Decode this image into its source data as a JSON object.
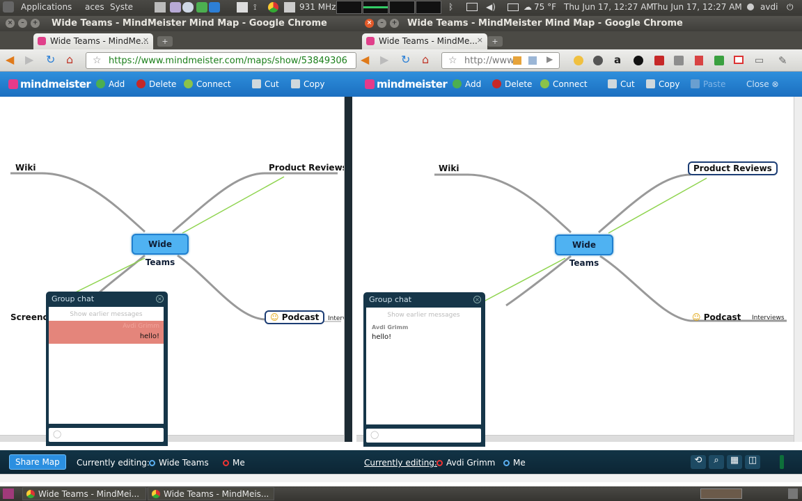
{
  "panel": {
    "applications": "Applications",
    "places": "aces",
    "system": "Syste",
    "cpu": "931 MHz",
    "weather": "75 °F",
    "clock1": "Thu Jun 17, 12:27 AM",
    "clock2": "Thu Jun 17, 12:27 AM",
    "user": "avdi"
  },
  "left_window": {
    "title": "Wide Teams - MindMeister Mind Map - Google Chrome",
    "tab_label": "Wide Teams - MindMe...",
    "url": "https://www.mindmeister.com/maps/show/53849306",
    "toolbar": {
      "add": "Add",
      "delete": "Delete",
      "connect": "Connect",
      "cut": "Cut",
      "copy": "Copy"
    },
    "nodes": {
      "center": "Wide Teams",
      "wiki": "Wiki",
      "product_reviews": "Product Reviews",
      "screencasts": "Screenca",
      "podcast": "Podcast",
      "interviews": "Interv"
    },
    "chat": {
      "title": "Group chat",
      "show_earlier": "Show earlier messages",
      "sender": "Avdi Grimm",
      "message": "hello!"
    },
    "bottom": {
      "share": "Share Map",
      "editing_label": "Currently editing:",
      "editor1": "Wide Teams",
      "editor2": "Me"
    }
  },
  "right_window": {
    "title": "Wide Teams - MindMeister Mind Map - Google Chrome",
    "tab_label": "Wide Teams - MindMe...",
    "url": "http://www",
    "toolbar": {
      "add": "Add",
      "delete": "Delete",
      "connect": "Connect",
      "cut": "Cut",
      "copy": "Copy",
      "paste": "Paste",
      "close": "Close"
    },
    "nodes": {
      "center": "Wide Teams",
      "wiki": "Wiki",
      "product_reviews": "Product Reviews",
      "podcast": "Podcast",
      "interviews": "Interviews"
    },
    "chat": {
      "title": "Group chat",
      "show_earlier": "Show earlier messages",
      "sender": "Avdi Grimm",
      "message": "hello!"
    },
    "bottom": {
      "editing_label": "Currently editing:",
      "editor1": "Avdi Grimm",
      "editor2": "Me"
    }
  },
  "taskbar": {
    "item1": "Wide Teams - MindMei...",
    "item2": "Wide Teams - MindMeis..."
  },
  "colors": {
    "accent": "#1b6fc0",
    "node_fill": "#4fb2f2",
    "chat_bg": "#163649",
    "link_green": "#7fd13a"
  }
}
